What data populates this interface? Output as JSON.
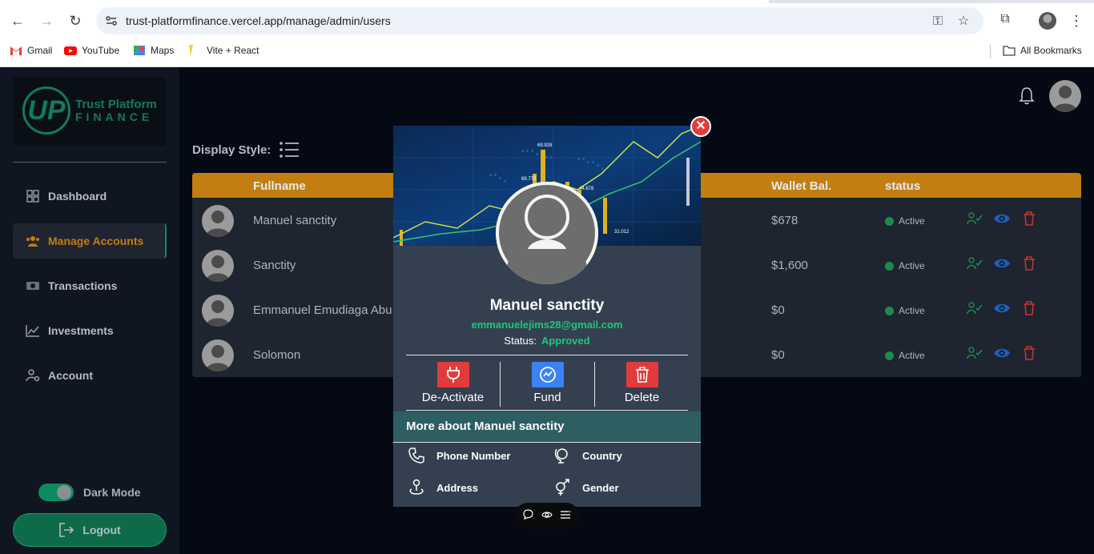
{
  "browser": {
    "url": "trust-platformfinance.vercel.app/manage/admin/users",
    "bookmarks": [
      "Gmail",
      "YouTube",
      "Maps",
      "Vite + React"
    ],
    "all_bookmarks": "All Bookmarks"
  },
  "logo": {
    "line1": "Trust Platform",
    "line2": "FINANCE",
    "monogram": "UP"
  },
  "sidebar": {
    "items": [
      {
        "label": "Dashboard",
        "icon": "grid-icon"
      },
      {
        "label": "Manage Accounts",
        "icon": "users-icon",
        "active": true
      },
      {
        "label": "Transactions",
        "icon": "money-icon"
      },
      {
        "label": "Investments",
        "icon": "chart-icon"
      },
      {
        "label": "Account",
        "icon": "user-gear-icon"
      }
    ],
    "dark_mode_label": "Dark Mode",
    "dark_mode_on": true,
    "logout_label": "Logout"
  },
  "main": {
    "display_style_label": "Display Style:",
    "table": {
      "headers": {
        "fullname": "Fullname",
        "wallet": "Wallet Bal.",
        "status": "status"
      },
      "rows": [
        {
          "name": "Manuel sanctity",
          "wallet": "$678",
          "status": "Active"
        },
        {
          "name": "Sanctity",
          "wallet": "$1,600",
          "status": "Active"
        },
        {
          "name": "Emmanuel Emudiaga Abu",
          "wallet": "$0",
          "status": "Active"
        },
        {
          "name": "Solomon",
          "wallet": "$0",
          "status": "Active"
        }
      ]
    }
  },
  "modal": {
    "name": "Manuel sanctity",
    "email": "emmanuelejims28@gmail.com",
    "status_label": "Status:",
    "status_value": "Approved",
    "buttons": {
      "deactivate": "De-Activate",
      "fund": "Fund",
      "delete": "Delete"
    },
    "more_title": "More about Manuel sanctity",
    "fields": {
      "phone": "Phone Number",
      "country": "Country",
      "address": "Address",
      "gender": "Gender"
    },
    "banner_numbers": [
      "69.928",
      "69.772",
      "44.678",
      "31.012"
    ]
  },
  "colors": {
    "accent": "#c27e10",
    "brand_green": "#0d8a5f",
    "approved": "#19c97a",
    "danger": "#e23b3b",
    "fund_blue": "#3b82f6"
  }
}
